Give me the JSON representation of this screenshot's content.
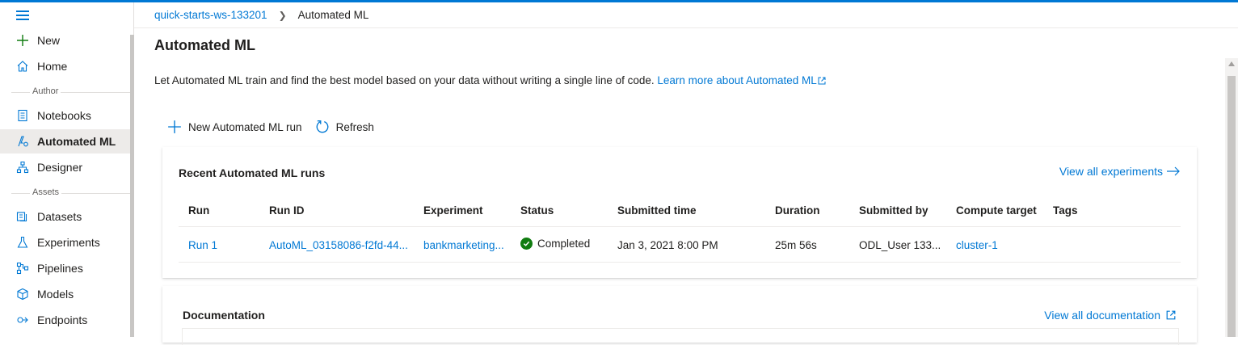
{
  "colors": {
    "accent": "#0078d4",
    "success": "#107c10",
    "text": "#201f1e",
    "muted": "#605e5c"
  },
  "sidebar": {
    "menu_icon": "hamburger-icon",
    "items": [
      {
        "label": "New",
        "icon": "plus-icon"
      },
      {
        "label": "Home",
        "icon": "home-icon"
      },
      {
        "label": "Notebooks",
        "icon": "notebook-icon"
      },
      {
        "label": "Automated ML",
        "icon": "automated-ml-icon",
        "selected": true
      },
      {
        "label": "Designer",
        "icon": "designer-icon"
      },
      {
        "label": "Datasets",
        "icon": "datasets-icon"
      },
      {
        "label": "Experiments",
        "icon": "flask-icon"
      },
      {
        "label": "Pipelines",
        "icon": "pipelines-icon"
      },
      {
        "label": "Models",
        "icon": "cube-icon"
      },
      {
        "label": "Endpoints",
        "icon": "endpoints-icon"
      }
    ],
    "sections": {
      "author": "Author",
      "assets": "Assets"
    }
  },
  "breadcrumb": {
    "workspace": "quick-starts-ws-133201",
    "current": "Automated ML"
  },
  "page": {
    "title": "Automated ML",
    "description": "Let Automated ML train and find the best model based on your data without writing a single line of code.",
    "learn_more": "Learn more about Automated ML"
  },
  "toolbar": {
    "new_run": "New Automated ML run",
    "refresh": "Refresh"
  },
  "runs_card": {
    "title": "Recent Automated ML runs",
    "view_all": "View all experiments",
    "columns": [
      "Run",
      "Run ID",
      "Experiment",
      "Status",
      "Submitted time",
      "Duration",
      "Submitted by",
      "Compute target",
      "Tags"
    ],
    "rows": [
      {
        "run": "Run 1",
        "run_id": "AutoML_03158086-f2fd-44...",
        "experiment": "bankmarketing...",
        "status": "Completed",
        "submitted_time": "Jan 3, 2021 8:00 PM",
        "duration": "25m 56s",
        "submitted_by": "ODL_User 133...",
        "compute_target": "cluster-1",
        "tags": ""
      }
    ]
  },
  "docs_card": {
    "title": "Documentation",
    "view_all": "View all documentation"
  }
}
